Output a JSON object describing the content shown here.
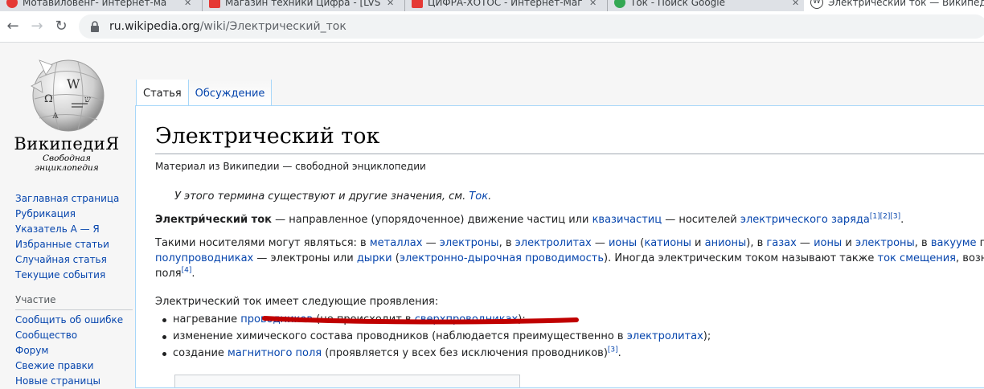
{
  "browser": {
    "tabs": [
      {
        "title": "Мотавиловенг- интернет-ма",
        "favicon_color": "#e53935"
      },
      {
        "title": "Магазин техники Цифра - [LVS",
        "favicon_color": "#e53935"
      },
      {
        "title": "ЦИФРА-ХОТОС - Интернет-Маг",
        "favicon_color": "#e53935"
      },
      {
        "title": "Ток - Поиск Google",
        "favicon_color": "#34a853"
      },
      {
        "title": "Электрический ток — Википедия",
        "favicon_color": "#000000"
      }
    ],
    "url_host": "ru.wikipedia.org",
    "url_path": "/wiki/Электрический_ток"
  },
  "wiki": {
    "wordmark": "ВикипедиЯ",
    "tagline": "Свободная энциклопедия",
    "logo_glyphs": [
      "W",
      "Ω",
      "Ѧ",
      "ש"
    ],
    "nav_items": [
      "Заглавная страница",
      "Рубрикация",
      "Указатель А — Я",
      "Избранные статьи",
      "Случайная статья",
      "Текущие события"
    ],
    "participation_heading": "Участие",
    "participation_items": [
      "Сообщить об ошибке",
      "Сообщество",
      "Форум",
      "Свежие правки",
      "Новые страницы"
    ],
    "tabs": [
      "Статья",
      "Обсуждение"
    ]
  },
  "article": {
    "title": "Электрический ток",
    "site_sub": "Материал из Википедии — свободной энциклопедии",
    "hatnote_text": "У этого термина существуют и другие значения, см. ",
    "hatnote_link": "Ток",
    "hatnote_end": ".",
    "p1": {
      "bold": "Электри́ческий ток",
      "t1": " — направленное (упорядоченное) движение частиц или ",
      "l1": "квазичастиц",
      "t2": " — носителей ",
      "l2": "электрического заряда",
      "refs": "[1][2][3]",
      "t3": "."
    },
    "p2": {
      "t1": "Такими носителями могут являться: в ",
      "l1": "металлах",
      "t2": " — ",
      "l2": "электроны",
      "t3": ", в ",
      "l3": "электролитах",
      "t4": " — ",
      "l4": "ионы",
      "t5": " (",
      "l5": "катионы",
      "t6": " и ",
      "l6": "анионы",
      "t7": "), в ",
      "l7": "газах",
      "t8": " — ",
      "l8": "ионы",
      "t9": " и ",
      "l9": "электроны",
      "t10": ", в ",
      "l10": "вакууме",
      "t11": " при опред",
      "l11": "полупроводниках",
      "t12": " — электроны или ",
      "l12": "дырки",
      "t13": " (",
      "l13": "электронно-дырочная проводимость",
      "t14": "). Иногда электрическим током называют также ",
      "l14": "ток смещения",
      "t15": ", возникающий в",
      "t16": "поля",
      "ref": "[4]",
      "t17": "."
    },
    "p3": "Электрический ток имеет следующие проявления:",
    "list": [
      {
        "t1": "нагревание ",
        "l1": "проводников",
        "t2": " (не происходит в ",
        "l2": "сверхпроводниках",
        "t3": ");"
      },
      {
        "t1": "изменение химического состава проводников (наблюдается преимущественно в ",
        "l1": "электролитах",
        "t2": ");"
      },
      {
        "t1": "создание ",
        "l1": "магнитного поля",
        "t2": " (проявляется у всех без исключения проводников)",
        "ref": "[3]",
        "t3": "."
      }
    ]
  },
  "colors": {
    "link": "#0645ad",
    "annotation_red": "#c00000"
  }
}
